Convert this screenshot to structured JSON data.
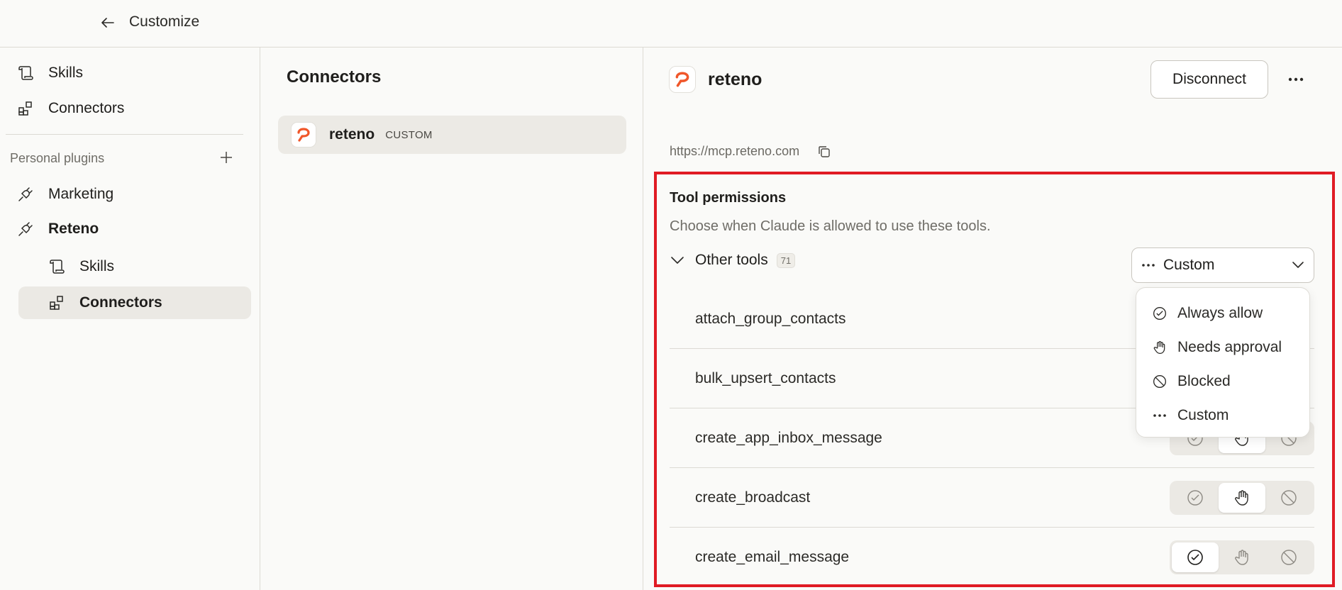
{
  "topbar": {
    "title": "Customize"
  },
  "sidebar": {
    "top_items": [
      {
        "label": "Skills",
        "icon": "scroll-icon"
      },
      {
        "label": "Connectors",
        "icon": "grid-icon"
      }
    ],
    "section_label": "Personal plugins",
    "plugins": [
      {
        "label": "Marketing",
        "icon": "plug-icon"
      },
      {
        "label": "Reteno",
        "icon": "plug-icon"
      }
    ],
    "sub_items": [
      {
        "label": "Skills",
        "icon": "scroll-icon"
      },
      {
        "label": "Connectors",
        "icon": "grid-icon",
        "active": true
      }
    ]
  },
  "middle": {
    "title": "Connectors",
    "connectors": [
      {
        "name": "reteno",
        "tag": "CUSTOM"
      }
    ]
  },
  "detail": {
    "name": "reteno",
    "disconnect_label": "Disconnect",
    "url": "https://mcp.reteno.com",
    "permissions": {
      "title": "Tool permissions",
      "description": "Choose when Claude is allowed to use these tools.",
      "group_label": "Other tools",
      "group_count": "71",
      "select_value": "Custom",
      "dropdown_options": [
        {
          "label": "Always allow",
          "icon": "check-circle-icon"
        },
        {
          "label": "Needs approval",
          "icon": "hand-icon"
        },
        {
          "label": "Blocked",
          "icon": "blocked-icon"
        },
        {
          "label": "Custom",
          "icon": "ellipsis-icon"
        }
      ],
      "tools": [
        {
          "name": "attach_group_contacts",
          "state": "hidden"
        },
        {
          "name": "bulk_upsert_contacts",
          "state": "hidden"
        },
        {
          "name": "create_app_inbox_message",
          "state": "needs-approval"
        },
        {
          "name": "create_broadcast",
          "state": "needs-approval"
        },
        {
          "name": "create_email_message",
          "state": "always-allow"
        }
      ]
    }
  },
  "colors": {
    "accent_red": "#e01b24",
    "logo_orange": "#f0572a"
  }
}
